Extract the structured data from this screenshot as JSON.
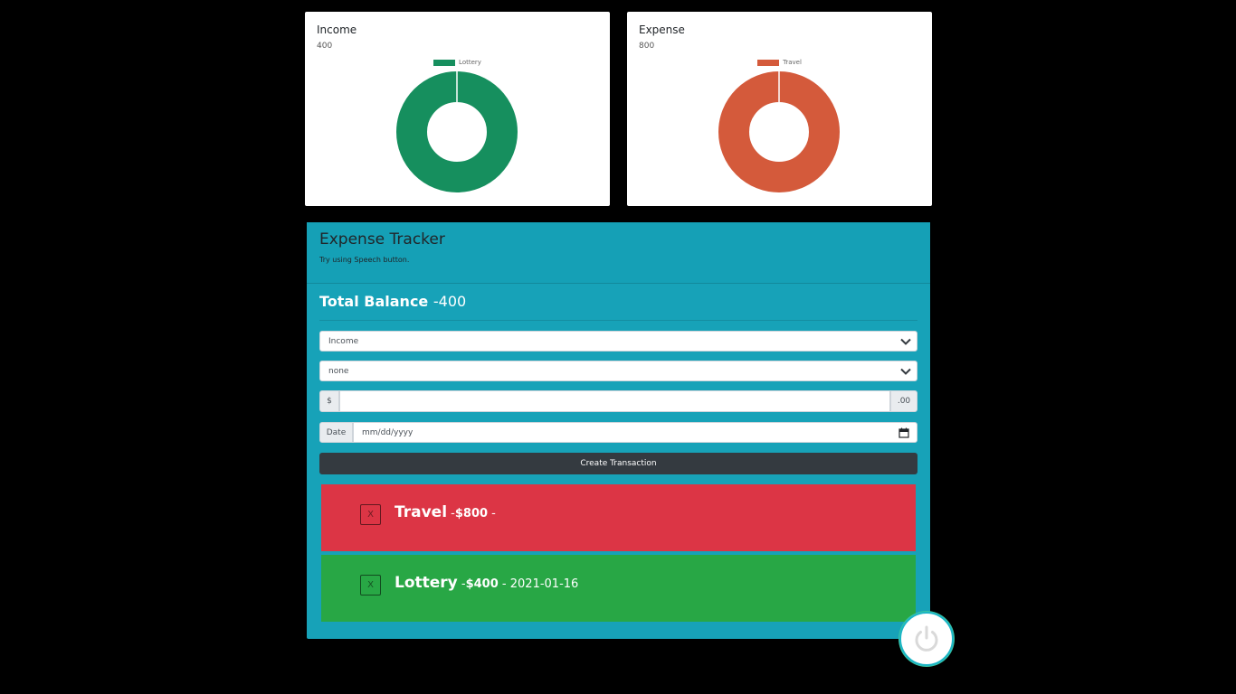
{
  "income_card": {
    "title": "Income",
    "amount": "400",
    "legend": "Lottery",
    "color": "#168f5e"
  },
  "expense_card": {
    "title": "Expense",
    "amount": "800",
    "legend": "Travel",
    "color": "#d45a3b"
  },
  "chart_data": [
    {
      "type": "pie",
      "title": "Income",
      "categories": [
        "Lottery"
      ],
      "values": [
        400
      ],
      "colors": [
        "#168f5e"
      ],
      "donut": true,
      "legend": "top"
    },
    {
      "type": "pie",
      "title": "Expense",
      "categories": [
        "Travel"
      ],
      "values": [
        800
      ],
      "colors": [
        "#d45a3b"
      ],
      "donut": true,
      "legend": "top"
    }
  ],
  "tracker": {
    "title": "Expense Tracker",
    "subtitle": "Try using Speech button.",
    "balance_label": "Total Balance",
    "balance_value": "-400",
    "type_select": "Income",
    "category_select": "none",
    "currency_prefix": "$",
    "currency_suffix": ".00",
    "amount_value": "",
    "date_label": "Date",
    "date_placeholder": "mm/dd/yyyy",
    "create_label": "Create Transaction"
  },
  "transactions": [
    {
      "delete_label": "X",
      "name": "Travel",
      "sep1": " -",
      "amount": "$800",
      "sep2": " - ",
      "date": "",
      "color": "#dc3545"
    },
    {
      "delete_label": "X",
      "name": "Lottery",
      "sep1": " -",
      "amount": "$400",
      "sep2": " - ",
      "date": "2021-01-16",
      "color": "#28a745"
    }
  ],
  "speech_button": {
    "icon": "power-icon"
  }
}
